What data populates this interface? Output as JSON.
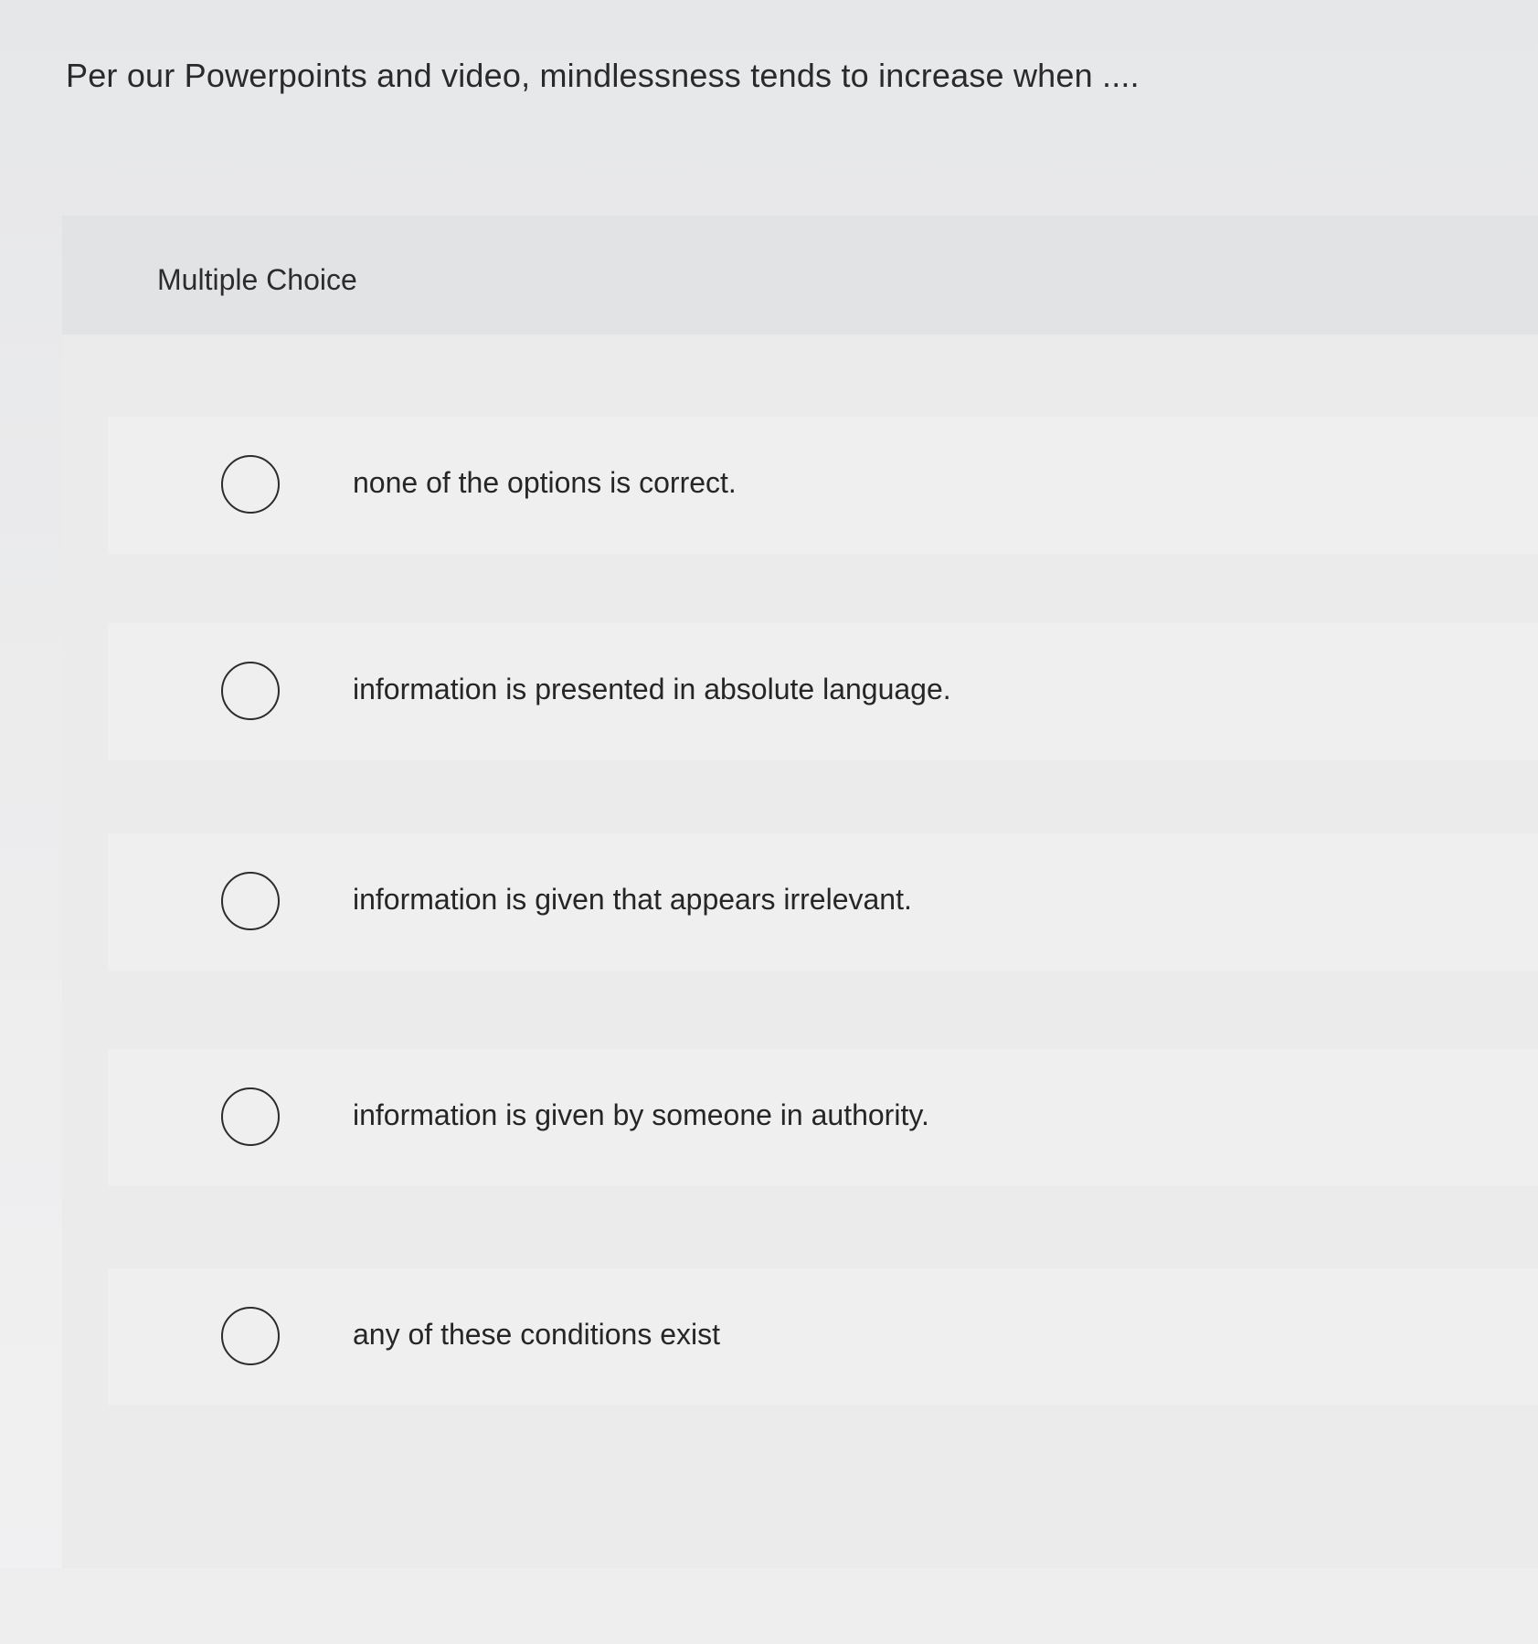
{
  "question": {
    "text": "Per our Powerpoints and video, mindlessness tends to increase when ...."
  },
  "card": {
    "type_label": "Multiple Choice",
    "options": [
      {
        "label": "none of the options is correct.",
        "selected": false
      },
      {
        "label": "information is presented in absolute language.",
        "selected": false
      },
      {
        "label": "information is given that appears irrelevant.",
        "selected": false
      },
      {
        "label": "information is given by someone in authority.",
        "selected": false
      },
      {
        "label": "any of these conditions exist",
        "selected": false
      }
    ]
  }
}
